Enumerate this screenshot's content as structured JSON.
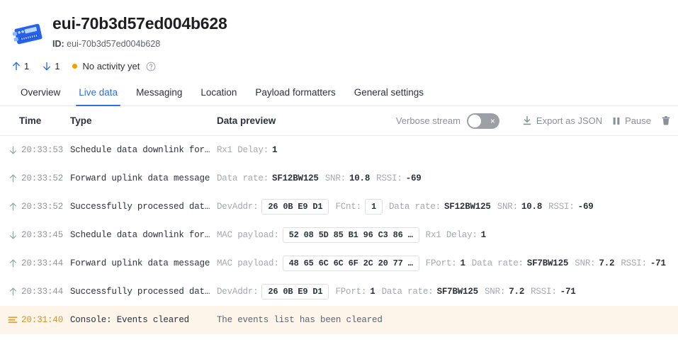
{
  "header": {
    "device_icon": "device-board-icon",
    "title": "eui-70b3d57ed004b628",
    "id_label": "ID:",
    "id_value": "eui-70b3d57ed004b628"
  },
  "status": {
    "uplink_icon": "arrow-up-icon",
    "uplink_count": "1",
    "downlink_icon": "arrow-down-icon",
    "downlink_count": "1",
    "activity_text": "No activity yet",
    "activity_dot_color": "#f0a000",
    "help_icon": "question-circle-icon"
  },
  "tabs": [
    {
      "label": "Overview",
      "active": false
    },
    {
      "label": "Live data",
      "active": true
    },
    {
      "label": "Messaging",
      "active": false
    },
    {
      "label": "Location",
      "active": false
    },
    {
      "label": "Payload formatters",
      "active": false
    },
    {
      "label": "General settings",
      "active": false
    }
  ],
  "table": {
    "columns": {
      "time": "Time",
      "type": "Type",
      "data_preview": "Data preview"
    },
    "toolbar": {
      "verbose_label": "Verbose stream",
      "verbose_enabled": false,
      "toggle_off_glyph": "×",
      "export_icon": "download-icon",
      "export_label": "Export as JSON",
      "pause_icon": "pause-icon",
      "pause_label": "Pause",
      "delete_icon": "trash-icon"
    }
  },
  "accent_color": "#2f6fdb",
  "highlight_bg": "#fdf5ea",
  "events": [
    {
      "direction": "down",
      "arrow_icon": "arrow-down-icon",
      "time": "20:33:53",
      "type": "Schedule data downlink for…",
      "fields": [
        {
          "kind": "kv",
          "key": "Rx1 Delay:",
          "value": "1"
        }
      ]
    },
    {
      "direction": "up",
      "arrow_icon": "arrow-up-icon",
      "time": "20:33:52",
      "type": "Forward uplink data message",
      "fields": [
        {
          "kind": "kv",
          "key": "Data rate:",
          "value": "SF12BW125"
        },
        {
          "kind": "kv",
          "key": "SNR:",
          "value": "10.8"
        },
        {
          "kind": "kv",
          "key": "RSSI:",
          "value": "-69"
        }
      ]
    },
    {
      "direction": "up",
      "arrow_icon": "arrow-up-icon",
      "time": "20:33:52",
      "type": "Successfully processed dat…",
      "fields": [
        {
          "kind": "chip",
          "key": "DevAddr:",
          "value": "26 0B E9 D1"
        },
        {
          "kind": "chip",
          "key": "FCnt:",
          "value": "1"
        },
        {
          "kind": "kv",
          "key": "Data rate:",
          "value": "SF12BW125"
        },
        {
          "kind": "kv",
          "key": "SNR:",
          "value": "10.8"
        },
        {
          "kind": "kv",
          "key": "RSSI:",
          "value": "-69"
        }
      ]
    },
    {
      "direction": "down",
      "arrow_icon": "arrow-down-icon",
      "time": "20:33:45",
      "type": "Schedule data downlink for…",
      "fields": [
        {
          "kind": "chip",
          "key": "MAC payload:",
          "value": "52 08 5D 85 B1 96 C3 86 …"
        },
        {
          "kind": "kv",
          "key": "Rx1 Delay:",
          "value": "1"
        }
      ]
    },
    {
      "direction": "up",
      "arrow_icon": "arrow-up-icon",
      "time": "20:33:44",
      "type": "Forward uplink data message",
      "fields": [
        {
          "kind": "chip",
          "key": "MAC payload:",
          "value": "48 65 6C 6C 6F 2C 20 77 …"
        },
        {
          "kind": "kv",
          "key": "FPort:",
          "value": "1"
        },
        {
          "kind": "kv",
          "key": "Data rate:",
          "value": "SF7BW125"
        },
        {
          "kind": "kv",
          "key": "SNR:",
          "value": "7.2"
        },
        {
          "kind": "kv",
          "key": "RSSI:",
          "value": "-71"
        }
      ]
    },
    {
      "direction": "up",
      "arrow_icon": "arrow-up-icon",
      "time": "20:33:44",
      "type": "Successfully processed dat…",
      "fields": [
        {
          "kind": "chip",
          "key": "DevAddr:",
          "value": "26 0B E9 D1"
        },
        {
          "kind": "kv",
          "key": "FPort:",
          "value": "1"
        },
        {
          "kind": "kv",
          "key": "Data rate:",
          "value": "SF7BW125"
        },
        {
          "kind": "kv",
          "key": "SNR:",
          "value": "7.2"
        },
        {
          "kind": "kv",
          "key": "RSSI:",
          "value": "-71"
        }
      ]
    },
    {
      "direction": "console",
      "arrow_icon": "console-lines-icon",
      "highlight": true,
      "time": "20:31:40",
      "type": "Console: Events cleared",
      "fields": [
        {
          "kind": "text",
          "value": "The events list has been cleared"
        }
      ]
    }
  ]
}
